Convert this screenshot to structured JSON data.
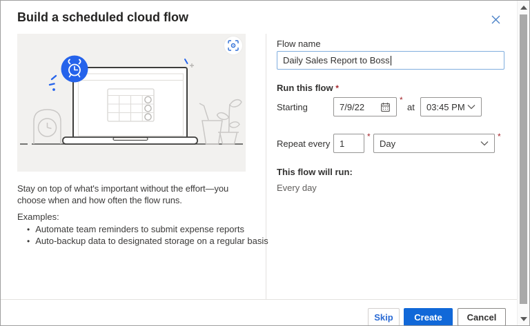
{
  "dialog": {
    "title": "Build a scheduled cloud flow"
  },
  "left": {
    "blurb": "Stay on top of what's important without the effort—you choose when and how often the flow runs.",
    "examples_label": "Examples:",
    "bullet_glyph": "•",
    "examples": [
      "Automate team reminders to submit expense reports",
      "Auto-backup data to designated storage on a regular basis"
    ]
  },
  "form": {
    "flow_name_label": "Flow name",
    "flow_name_value": "Daily Sales Report to Boss",
    "run_label": "Run this flow",
    "required_mark": "*",
    "starting_label": "Starting",
    "date_value": "7/9/22",
    "at_label": "at",
    "time_value": "03:45 PM",
    "repeat_label": "Repeat every",
    "interval_value": "1",
    "unit_value": "Day",
    "summary_label": "This flow will run:",
    "summary_value": "Every day"
  },
  "footer": {
    "skip": "Skip",
    "create": "Create",
    "cancel": "Cancel"
  },
  "icons": {
    "close": "close-x-icon",
    "screenshot_focus": "focus-frame-icon",
    "calendar": "calendar-icon",
    "chevron": "chevron-down-icon",
    "alarm": "alarm-clock-icon"
  },
  "colors": {
    "accent_blue": "#1168d8",
    "link_blue": "#2b6bd4",
    "close_blue": "#4a82c8",
    "alarm_blue": "#2563eb",
    "required_red": "#a4262c",
    "text_primary": "#323130",
    "text_secondary": "#605e5c",
    "focused_input_border": "#7fadde",
    "input_border": "#959493",
    "illustration_bg": "#f2f1ef"
  }
}
